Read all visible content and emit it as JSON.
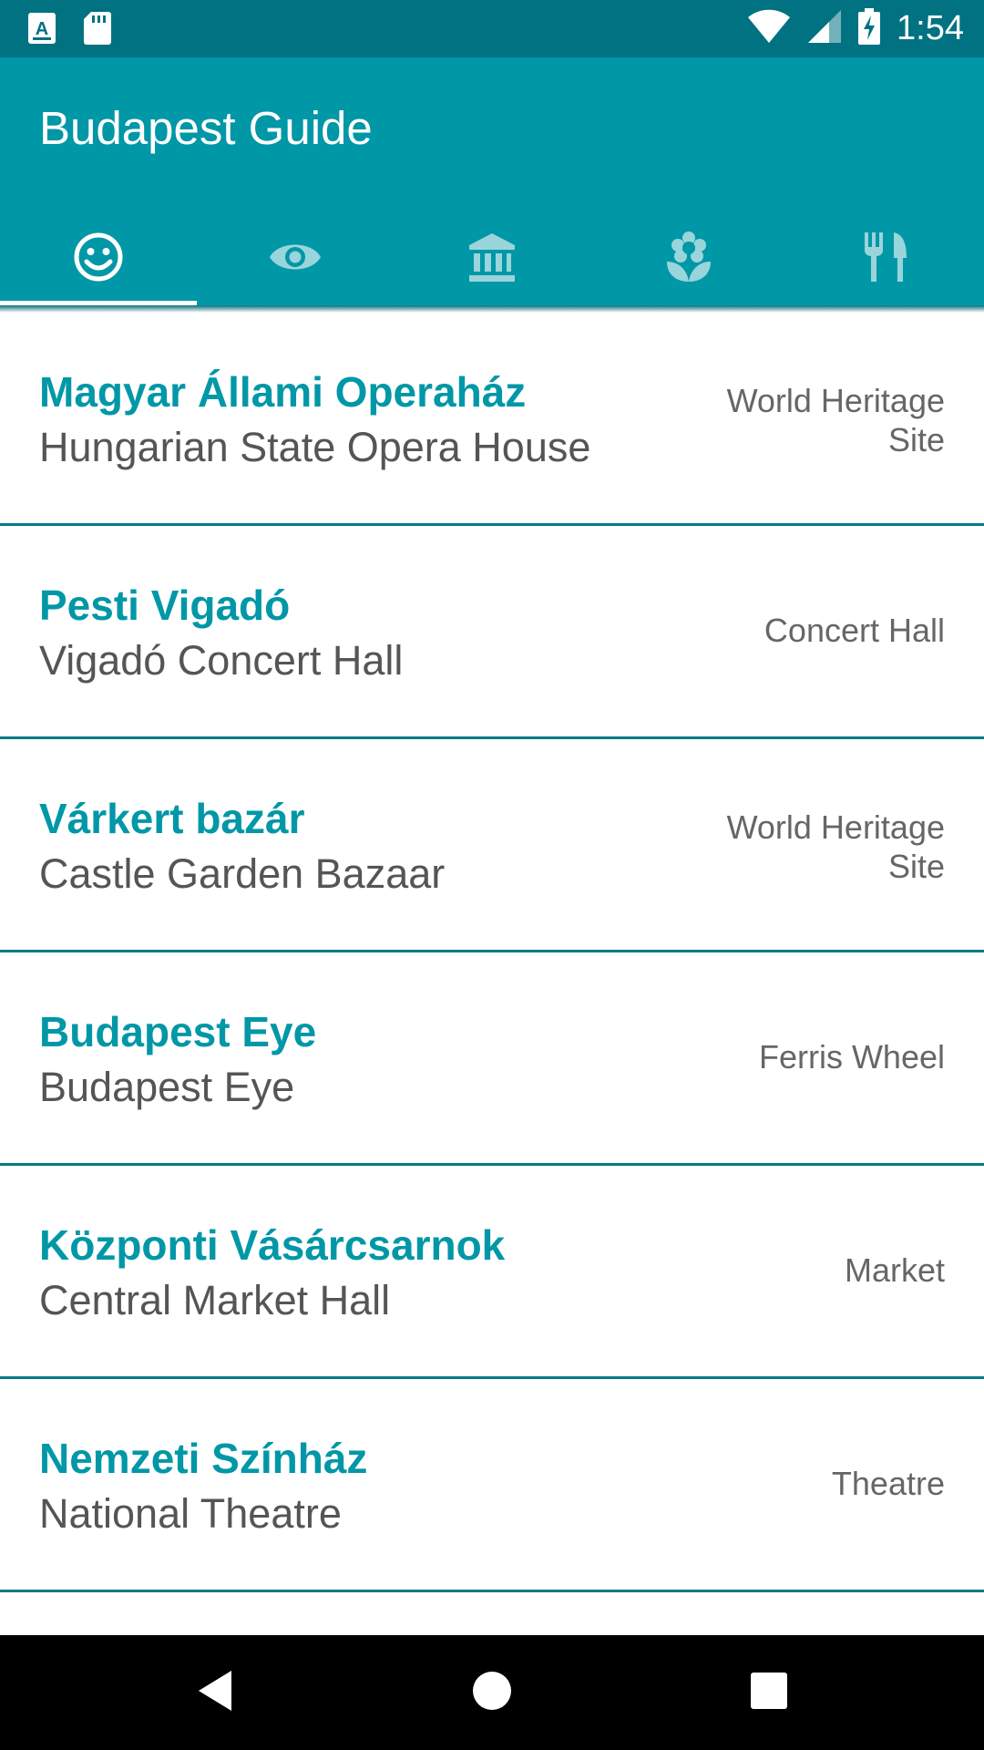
{
  "status_bar": {
    "time": "1:54",
    "icons": [
      "keyboard-a-icon",
      "sd-card-icon",
      "wifi-icon",
      "signal-icon",
      "battery-charging-icon"
    ]
  },
  "app_bar": {
    "title": "Budapest Guide"
  },
  "tabs": [
    {
      "icon": "smiley-icon",
      "selected": true
    },
    {
      "icon": "eye-icon",
      "selected": false
    },
    {
      "icon": "museum-icon",
      "selected": false
    },
    {
      "icon": "flower-icon",
      "selected": false
    },
    {
      "icon": "restaurant-icon",
      "selected": false
    }
  ],
  "colors": {
    "status_bar": "#007281",
    "app_bar": "#0097a7",
    "accent_text": "#0097a7",
    "divider": "#077a85"
  },
  "list": [
    {
      "name": "Magyar Állami Operaház",
      "translation": "Hungarian State Opera House",
      "category": "World Heritage Site"
    },
    {
      "name": "Pesti Vigadó",
      "translation": "Vigadó Concert Hall",
      "category": "Concert Hall"
    },
    {
      "name": "Várkert bazár",
      "translation": "Castle Garden Bazaar",
      "category": "World Heritage Site"
    },
    {
      "name": "Budapest Eye",
      "translation": "Budapest Eye",
      "category": "Ferris Wheel"
    },
    {
      "name": "Központi Vásárcsarnok",
      "translation": "Central Market Hall",
      "category": "Market"
    },
    {
      "name": "Nemzeti Színház",
      "translation": "National Theatre",
      "category": "Theatre"
    }
  ],
  "nav_bar": {
    "buttons": [
      "back-icon",
      "home-icon",
      "recents-icon"
    ]
  }
}
